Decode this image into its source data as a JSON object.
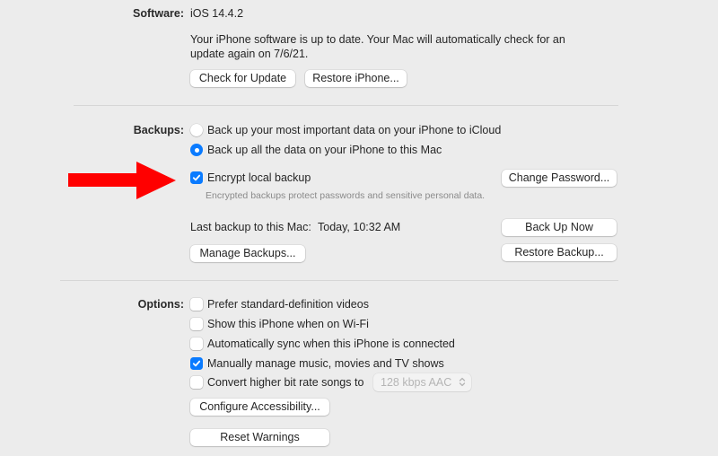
{
  "software": {
    "label": "Software:",
    "version": "iOS 14.4.2",
    "status_line1": "Your iPhone software is up to date. Your Mac will automatically check for an",
    "status_line2": "update again on 7/6/21.",
    "check_update_label": "Check for Update",
    "restore_iphone_label": "Restore iPhone..."
  },
  "backups": {
    "label": "Backups:",
    "options": [
      {
        "label": "Back up your most important data on your iPhone to iCloud",
        "selected": false
      },
      {
        "label": "Back up all the data on your iPhone to this Mac",
        "selected": true
      }
    ],
    "encrypt": {
      "label": "Encrypt local backup",
      "checked": true,
      "description": "Encrypted backups protect passwords and sensitive personal data."
    },
    "change_password_label": "Change Password...",
    "last_backup_label": "Last backup to this Mac:",
    "last_backup_value": "Today, 10:32 AM",
    "back_up_now_label": "Back Up Now",
    "manage_backups_label": "Manage Backups...",
    "restore_backup_label": "Restore Backup..."
  },
  "options": {
    "label": "Options:",
    "items": [
      {
        "label": "Prefer standard-definition videos",
        "checked": false
      },
      {
        "label": "Show this iPhone when on Wi-Fi",
        "checked": false
      },
      {
        "label": "Automatically sync when this iPhone is connected",
        "checked": false
      },
      {
        "label": "Manually manage music, movies and TV shows",
        "checked": true
      },
      {
        "label": "Convert higher bit rate songs to",
        "checked": false
      }
    ],
    "bitrate_select_value": "128 kbps AAC",
    "configure_accessibility_label": "Configure Accessibility...",
    "reset_warnings_label": "Reset Warnings"
  },
  "annotation": {
    "arrow_color": "#ff0000",
    "arrow_target": "Encrypt local backup"
  },
  "colors": {
    "background": "#ececec",
    "accent": "#0a7bff"
  }
}
